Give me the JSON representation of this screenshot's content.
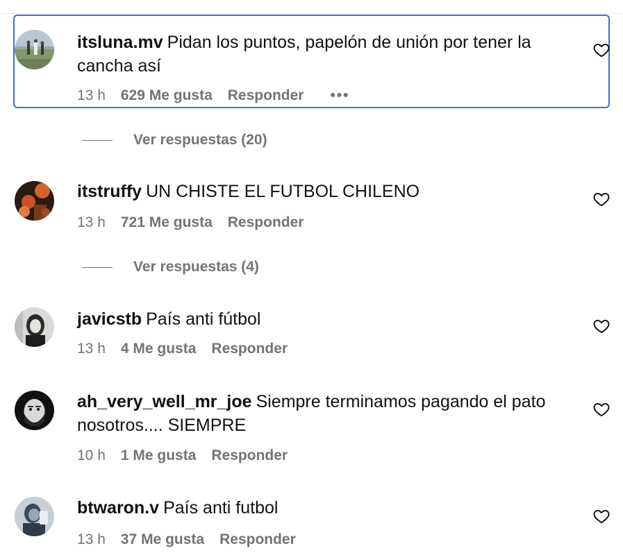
{
  "comments": [
    {
      "username": "itsluna.mv",
      "text": "Pidan los puntos, papelón de unión por tener la cancha así",
      "time": "13 h",
      "likes": "629 Me gusta",
      "reply_label": "Responder",
      "more_label": "•••",
      "avatar_icon": "soccer-field-photo",
      "replies_label": "Ver respuestas (20)"
    },
    {
      "username": "itstruffy",
      "text": "UN CHISTE EL FUTBOL CHILENO",
      "time": "13 h",
      "likes": "721 Me gusta",
      "reply_label": "Responder",
      "avatar_icon": "orange-balloons-photo",
      "replies_label": "Ver respuestas (4)"
    },
    {
      "username": "javicstb",
      "text": "País anti fútbol",
      "time": "13 h",
      "likes": "4 Me gusta",
      "reply_label": "Responder",
      "avatar_icon": "bw-portrait-photo"
    },
    {
      "username": "ah_very_well_mr_joe",
      "text": "Siempre terminamos pagando el pato nosotros.... SIEMPRE",
      "time": "10 h",
      "likes": "1 Me gusta",
      "reply_label": "Responder",
      "avatar_icon": "bearded-face-photo"
    },
    {
      "username": "btwaron.v",
      "text": "País anti futbol",
      "time": "13 h",
      "likes": "37 Me gusta",
      "reply_label": "Responder",
      "avatar_icon": "selfie-photo"
    }
  ],
  "colors": {
    "text": "#111111",
    "muted": "#737373",
    "focus": "#3a6fd8"
  }
}
